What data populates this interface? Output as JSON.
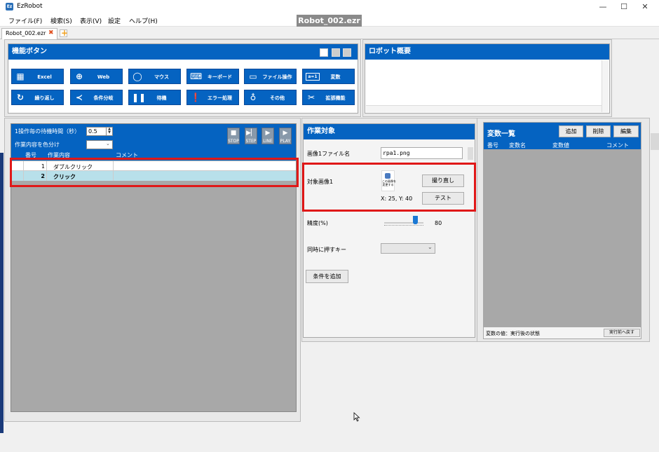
{
  "window": {
    "title": "EzRobot",
    "file_badge": "Robot_002.ezr",
    "app_icon": "Ez"
  },
  "menu": [
    "ファイル(F)",
    "検索(S)",
    "表示(V)",
    "設定",
    "ヘルプ(H)"
  ],
  "tab": {
    "label": "Robot_002.ezr",
    "close": "✖"
  },
  "function_panel": {
    "title": "機能ボタン",
    "buttons": [
      {
        "label": "Excel",
        "icon": "excel-icon"
      },
      {
        "label": "Web",
        "icon": "globe-icon"
      },
      {
        "label": "マウス",
        "icon": "mouse-icon"
      },
      {
        "label": "キーボード",
        "icon": "keyboard-icon"
      },
      {
        "label": "ファイル操作",
        "icon": "file-icon"
      },
      {
        "label": "変数",
        "icon": "variable-icon",
        "glyph": "a=1"
      },
      {
        "label": "繰り返し",
        "icon": "loop-icon"
      },
      {
        "label": "条件分岐",
        "icon": "branch-icon"
      },
      {
        "label": "待機",
        "icon": "pause-icon"
      },
      {
        "label": "エラー処理",
        "icon": "error-icon"
      },
      {
        "label": "その他",
        "icon": "bulb-icon"
      },
      {
        "label": "拡張機能",
        "icon": "tools-icon"
      }
    ]
  },
  "overview": {
    "title": "ロボット概要"
  },
  "flow": {
    "wait_label": "1操作毎の待機時間（秒）",
    "wait_value": "0.5",
    "color_label": "作業内容を色分け",
    "controls": [
      "STOP",
      "STEP",
      "LINE",
      "PLAY"
    ],
    "columns": [
      "番号",
      "作業内容",
      "コメント"
    ],
    "rows": [
      {
        "num": "1",
        "task": "ダブルクリック",
        "comment": ""
      },
      {
        "num": "2",
        "task": "クリック",
        "comment": ""
      }
    ]
  },
  "target": {
    "title": "作業対象",
    "image_file_label": "画像1ファイル名",
    "image_file_value": "rpa1.png",
    "image_label": "対象画像1",
    "thumb_text": "この画像を\n変更する",
    "coords": "X: 25, Y: 40",
    "retake_button": "撮り直し",
    "test_button": "テスト",
    "precision_label": "精度(%)",
    "precision_value": "80",
    "precision_fraction": 0.8,
    "key_label": "同時に押すキー",
    "add_condition_button": "条件を追加"
  },
  "variables": {
    "title": "変数一覧",
    "add": "追加",
    "delete": "削除",
    "edit": "編集",
    "columns": [
      "番号",
      "変数名",
      "変数値",
      "コメント"
    ],
    "footer": "変数の値：実行後の状態",
    "reset_button": "実行前へ戻す"
  }
}
